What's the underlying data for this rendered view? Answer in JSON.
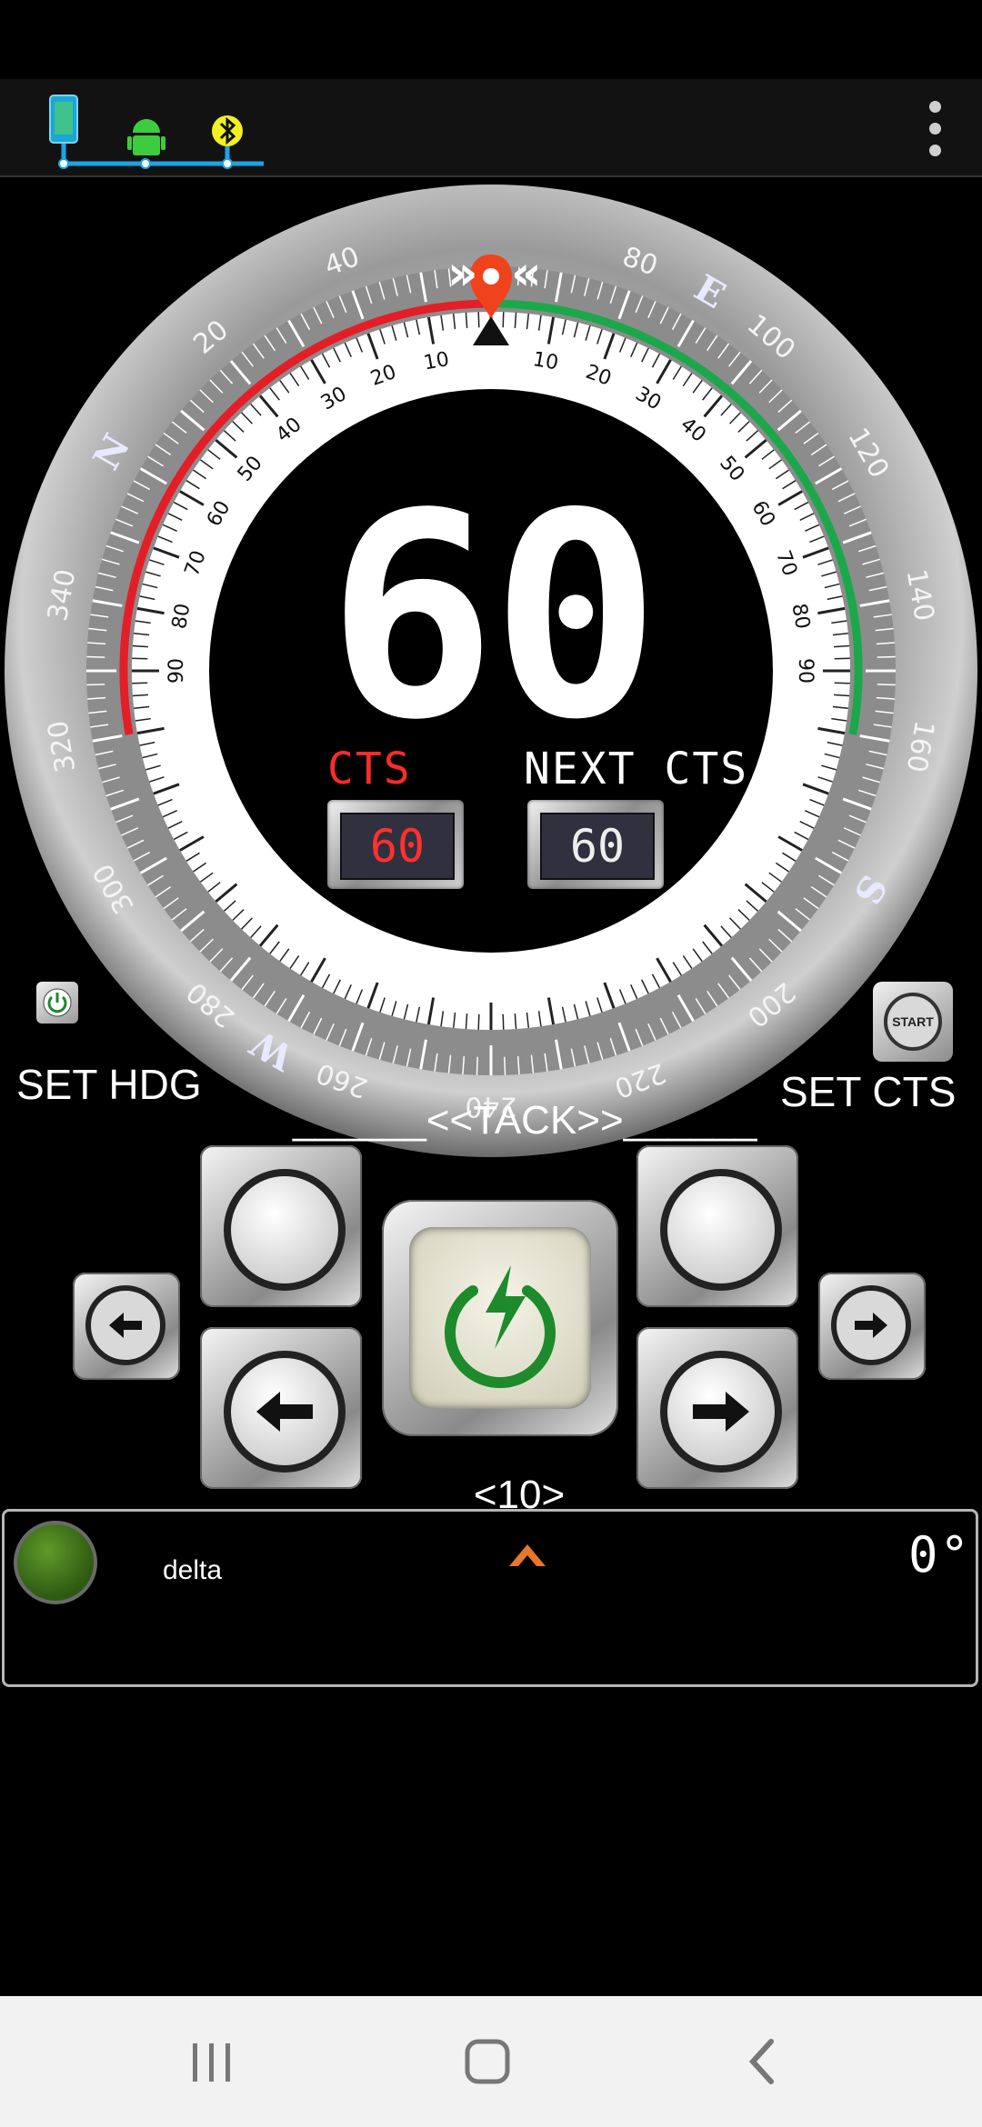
{
  "status_icons": [
    "phone-icon",
    "android-icon",
    "bluetooth-icon"
  ],
  "compass": {
    "heading_big": "60",
    "cts_label": "CTS",
    "next_cts_label": "NEXT CTS",
    "cts_value": "60",
    "next_cts_value": "60",
    "outer_ticks": [
      "20",
      "40",
      "80",
      "100",
      "120",
      "140",
      "160",
      "200",
      "220",
      "240",
      "260",
      "280",
      "300",
      "320",
      "340"
    ],
    "cardinals": [
      "N",
      "E",
      "S",
      "W"
    ],
    "inner_scale": [
      "10",
      "20",
      "30",
      "40",
      "50",
      "60",
      "70",
      "80",
      "90"
    ],
    "colors": {
      "port": "#e41e26",
      "starboard": "#1aa84a",
      "marker": "#f0431c"
    }
  },
  "controls": {
    "set_hdg_label": "SET HDG",
    "set_cts_label": "SET CTS",
    "start_label": "START",
    "tack_label": "______<<TACK>>______",
    "step_label": "______<10>______"
  },
  "panel": {
    "name": "delta",
    "degree_value": "0°"
  },
  "nav": [
    "recent-apps-icon",
    "home-icon",
    "back-icon"
  ]
}
